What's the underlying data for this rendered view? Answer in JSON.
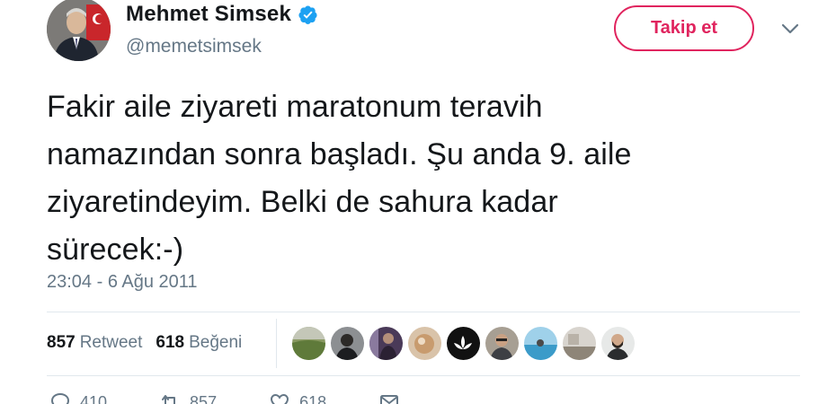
{
  "user": {
    "name": "Mehmet Simsek",
    "handle": "@memetsimsek",
    "verified": true
  },
  "follow_label": "Takip et",
  "tweet": {
    "lines": [
      "Fakir aile ziyareti maratonum teravih",
      "namazından sonra başladı. Şu anda 9. aile",
      "ziyaretindeyim. Belki de sahura kadar",
      "sürecek:-)"
    ],
    "timestamp": "23:04 - 6 Ağu 2011"
  },
  "stats": {
    "retweets": "857",
    "retweets_label": "Retweet",
    "likes": "618",
    "likes_label": "Beğeni"
  },
  "likers": [
    {
      "icon": "avatar-landscape"
    },
    {
      "icon": "avatar-person-car"
    },
    {
      "icon": "avatar-portrait-purple"
    },
    {
      "icon": "avatar-food"
    },
    {
      "icon": "avatar-lotus-logo"
    },
    {
      "icon": "avatar-person-glasses"
    },
    {
      "icon": "avatar-sea"
    },
    {
      "icon": "avatar-interior"
    },
    {
      "icon": "avatar-bearded-man"
    }
  ],
  "actions": {
    "reply_count": "410",
    "retweet_count": "857",
    "like_count": "618"
  },
  "colors": {
    "follow_accent": "#e0245e",
    "verified_blue": "#1da1f2",
    "secondary_text": "#657786",
    "primary_text": "#14171a",
    "divider": "#e1e8ed"
  }
}
